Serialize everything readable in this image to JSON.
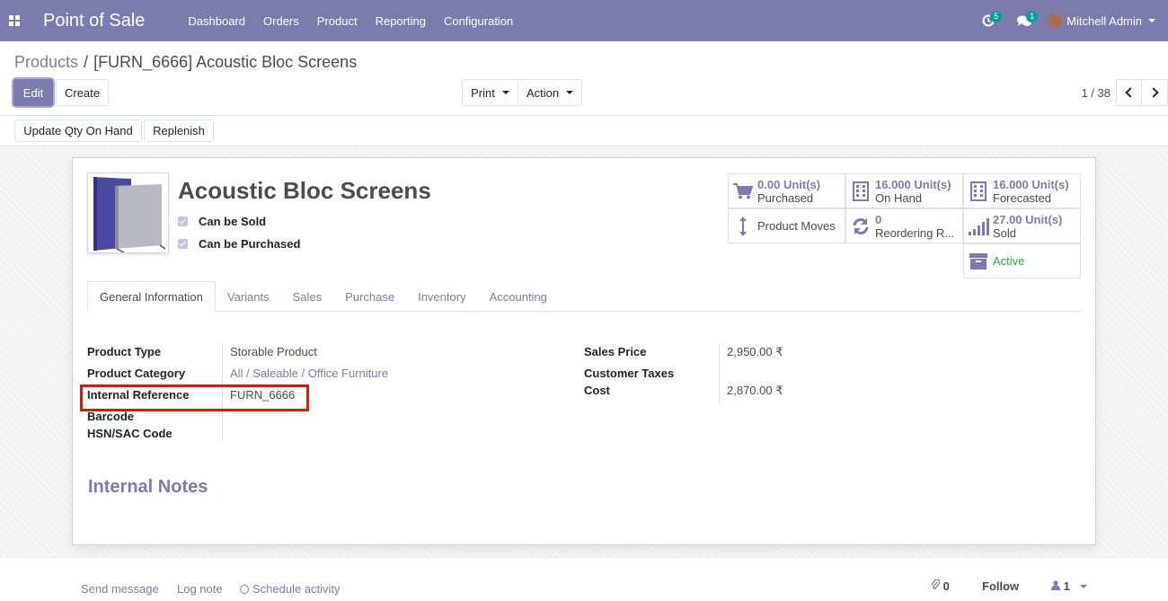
{
  "navbar": {
    "app_title": "Point of Sale",
    "menu": [
      "Dashboard",
      "Orders",
      "Product",
      "Reporting",
      "Configuration"
    ],
    "activity_badge": "5",
    "messages_badge": "1",
    "user_name": "Mitchell Admin",
    "icons": [
      "apps-grid-icon",
      "activity-clock-icon",
      "messages-icon",
      "user-avatar"
    ]
  },
  "breadcrumb": {
    "parent": "Products",
    "separator": "/",
    "current": "[FURN_6666] Acoustic Bloc Screens"
  },
  "toolbar": {
    "edit_label": "Edit",
    "create_label": "Create",
    "print_label": "Print",
    "action_label": "Action",
    "pager_value": "1 / 38"
  },
  "statusbar": {
    "update_qty_label": "Update Qty On Hand",
    "replenish_label": "Replenish"
  },
  "product": {
    "name": "Acoustic Bloc Screens",
    "can_be_sold_label": "Can be Sold",
    "can_be_purchased_label": "Can be Purchased",
    "can_be_sold": true,
    "can_be_purchased": true
  },
  "smart_buttons": {
    "purchased": {
      "value": "0.00",
      "unit": "Unit(s)",
      "label": "Purchased"
    },
    "on_hand": {
      "value": "16.000",
      "unit": "Unit(s)",
      "label": "On Hand"
    },
    "forecasted": {
      "value": "16.000",
      "unit": "Unit(s)",
      "label": "Forecasted"
    },
    "product_moves": {
      "label": "Product Moves"
    },
    "reordering": {
      "value": "0",
      "label": "Reordering R..."
    },
    "sold": {
      "value": "27.00",
      "unit": "Unit(s)",
      "label": "Sold"
    },
    "active": {
      "label": "Active"
    }
  },
  "tabs": [
    "General Information",
    "Variants",
    "Sales",
    "Purchase",
    "Inventory",
    "Accounting"
  ],
  "general_info": {
    "product_type_label": "Product Type",
    "product_type_value": "Storable Product",
    "product_category_label": "Product Category",
    "product_category_value": "All / Saleable / Office Furniture",
    "internal_reference_label": "Internal Reference",
    "internal_reference_value": "FURN_6666",
    "barcode_label": "Barcode",
    "hsn_label": "HSN/SAC Code",
    "sales_price_label": "Sales Price",
    "sales_price_value": "2,950.00 ₹",
    "customer_taxes_label": "Customer Taxes",
    "cost_label": "Cost",
    "cost_value": "2,870.00 ₹"
  },
  "internal_notes_title": "Internal Notes",
  "chatter": {
    "send_message": "Send message",
    "log_note": "Log note",
    "schedule_activity": "Schedule activity",
    "attachments_count": "0",
    "follow_label": "Follow",
    "followers_count": "1"
  },
  "colors": {
    "brand": "#7c7bad",
    "highlight": "#e31414",
    "active": "#28a745"
  }
}
